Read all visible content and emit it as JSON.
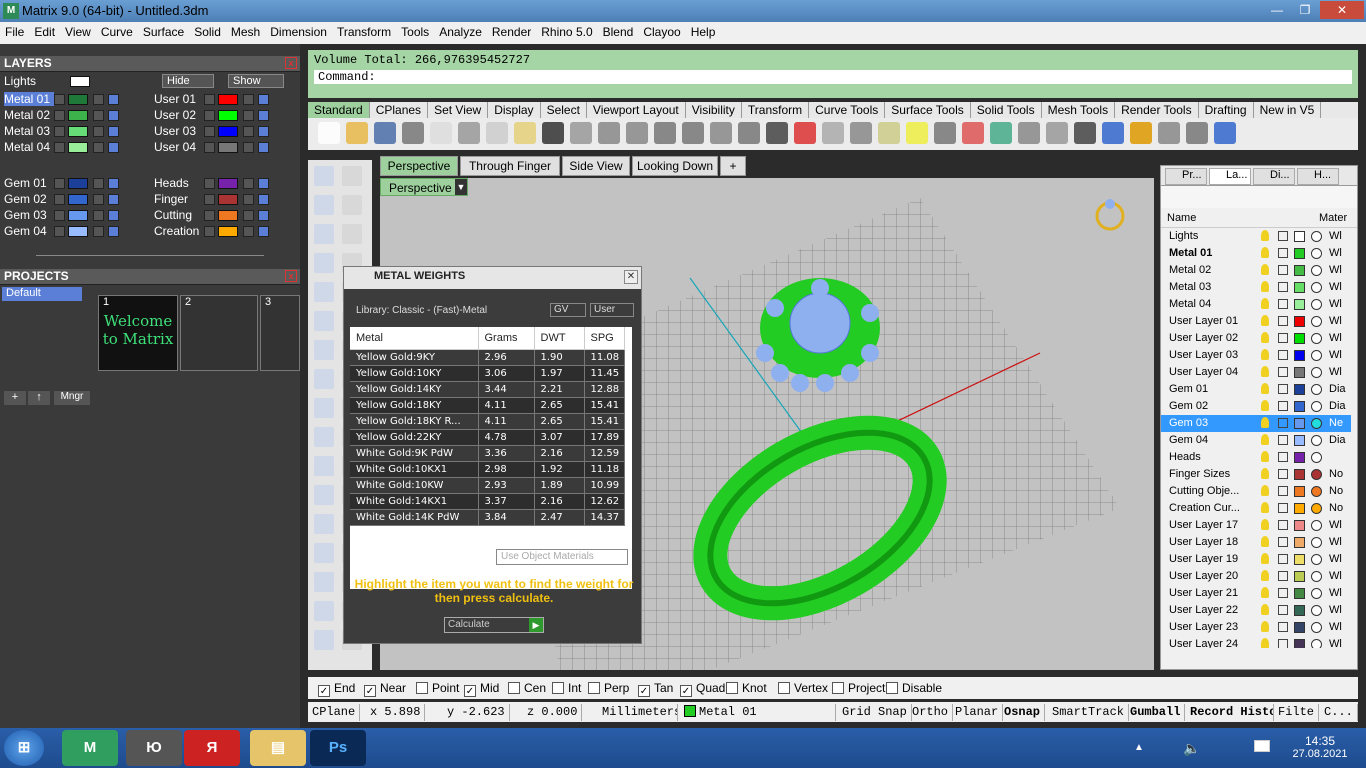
{
  "window": {
    "title": "Matrix 9.0 (64-bit) - Untitled.3dm"
  },
  "menu": [
    "File",
    "Edit",
    "View",
    "Curve",
    "Surface",
    "Solid",
    "Mesh",
    "Dimension",
    "Transform",
    "Tools",
    "Analyze",
    "Render",
    "Rhino 5.0",
    "Blend",
    "Clayoo",
    "Help"
  ],
  "layers_panel": {
    "title": "LAYERS",
    "lights": "Lights",
    "hide": "Hide",
    "show": "Show",
    "left": [
      {
        "name": "Metal 01",
        "color": "#1f7a3a"
      },
      {
        "name": "Metal 02",
        "color": "#3cb44b"
      },
      {
        "name": "Metal 03",
        "color": "#66dd77"
      },
      {
        "name": "Metal 04",
        "color": "#99ee99"
      }
    ],
    "right": [
      {
        "name": "User 01",
        "color": "#ff0000"
      },
      {
        "name": "User 02",
        "color": "#00ff00"
      },
      {
        "name": "User 03",
        "color": "#0000ff"
      },
      {
        "name": "User 04",
        "color": "#777777"
      }
    ],
    "gems": [
      {
        "name": "Gem 01",
        "color": "#1c3f99"
      },
      {
        "name": "Gem 02",
        "color": "#3366cc"
      },
      {
        "name": "Gem 03",
        "color": "#6699ee"
      },
      {
        "name": "Gem 04",
        "color": "#99bbff"
      }
    ],
    "other": [
      {
        "name": "Heads",
        "color": "#7722aa"
      },
      {
        "name": "Finger",
        "color": "#aa3333"
      },
      {
        "name": "Cutting",
        "color": "#ee7722"
      },
      {
        "name": "Creation",
        "color": "#ffaa00"
      }
    ]
  },
  "projects_panel": {
    "title": "PROJECTS",
    "item": "Default",
    "slots": [
      "1",
      "2",
      "3"
    ],
    "welcome": "Welcome to Matrix",
    "mngr": "Mngr"
  },
  "command": {
    "volume": "Volume Total: 266,976395452727",
    "prompt": "Command:"
  },
  "toolbar_tabs": [
    "Standard",
    "CPlanes",
    "Set View",
    "Display",
    "Select",
    "Viewport Layout",
    "Visibility",
    "Transform",
    "Curve Tools",
    "Surface Tools",
    "Solid Tools",
    "Mesh Tools",
    "Render Tools",
    "Drafting",
    "New in V5"
  ],
  "view_tabs": [
    "Perspective",
    "Through Finger",
    "Side View",
    "Looking Down",
    "+"
  ],
  "viewport_label": "Perspective",
  "metal_weights": {
    "title": "METAL WEIGHTS",
    "library": "Library: Classic - (Fast)-Metal",
    "gv": "GV",
    "user": "User",
    "columns": [
      "Metal",
      "Grams",
      "DWT",
      "SPG"
    ],
    "rows": [
      [
        "Yellow Gold:9KY",
        "2.96",
        "1.90",
        "11.08"
      ],
      [
        "Yellow Gold:10KY",
        "3.06",
        "1.97",
        "11.45"
      ],
      [
        "Yellow Gold:14KY",
        "3.44",
        "2.21",
        "12.88"
      ],
      [
        "Yellow Gold:18KY",
        "4.11",
        "2.65",
        "15.41"
      ],
      [
        "Yellow Gold:18KY R...",
        "4.11",
        "2.65",
        "15.41"
      ],
      [
        "Yellow Gold:22KY",
        "4.78",
        "3.07",
        "17.89"
      ],
      [
        "White Gold:9K PdW",
        "3.36",
        "2.16",
        "12.59"
      ],
      [
        "White Gold:10KX1",
        "2.98",
        "1.92",
        "11.18"
      ],
      [
        "White Gold:10KW",
        "2.93",
        "1.89",
        "10.99"
      ],
      [
        "White Gold:14KX1",
        "3.37",
        "2.16",
        "12.62"
      ],
      [
        "White Gold:14K PdW",
        "3.84",
        "2.47",
        "14.37"
      ]
    ],
    "use_object": "Use Object Materials",
    "note": "Highlight the item you want to find the weight for then press calculate.",
    "calculate": "Calculate"
  },
  "right_panel": {
    "tabs": [
      "Pr...",
      "La...",
      "Di...",
      "H..."
    ],
    "col_name": "Name",
    "col_mat": "Mater",
    "layers": [
      {
        "name": "Lights",
        "color": "#ffffff",
        "m": "Wl"
      },
      {
        "name": "Metal 01",
        "color": "#22cc22",
        "m": "Wl",
        "bold": true
      },
      {
        "name": "Metal 02",
        "color": "#44bb44",
        "m": "Wl"
      },
      {
        "name": "Metal 03",
        "color": "#66dd66",
        "m": "Wl"
      },
      {
        "name": "Metal 04",
        "color": "#99ee99",
        "m": "Wl"
      },
      {
        "name": "User Layer 01",
        "color": "#ee0000",
        "m": "Wl"
      },
      {
        "name": "User Layer 02",
        "color": "#00dd00",
        "m": "Wl"
      },
      {
        "name": "User Layer 03",
        "color": "#0000ee",
        "m": "Wl"
      },
      {
        "name": "User Layer 04",
        "color": "#777777",
        "m": "Wl"
      },
      {
        "name": "Gem 01",
        "color": "#1c3f99",
        "m": "Dia"
      },
      {
        "name": "Gem 02",
        "color": "#3366cc",
        "m": "Dia"
      },
      {
        "name": "Gem 03",
        "color": "#6699ee",
        "m": "Ne",
        "sel": true
      },
      {
        "name": "Gem 04",
        "color": "#99bbff",
        "m": "Dia"
      },
      {
        "name": "Heads",
        "color": "#7722aa",
        "m": ""
      },
      {
        "name": "Finger Sizes",
        "color": "#aa3333",
        "m": "No"
      },
      {
        "name": "Cutting Obje...",
        "color": "#ee7722",
        "m": "No"
      },
      {
        "name": "Creation Cur...",
        "color": "#ffaa00",
        "m": "No"
      },
      {
        "name": "User Layer 17",
        "color": "#ee8888",
        "m": "Wl"
      },
      {
        "name": "User Layer 18",
        "color": "#eeaa66",
        "m": "Wl"
      },
      {
        "name": "User Layer 19",
        "color": "#eedd66",
        "m": "Wl"
      },
      {
        "name": "User Layer 20",
        "color": "#bbcc55",
        "m": "Wl"
      },
      {
        "name": "User Layer 21",
        "color": "#448844",
        "m": "Wl"
      },
      {
        "name": "User Layer 22",
        "color": "#336655",
        "m": "Wl"
      },
      {
        "name": "User Layer 23",
        "color": "#334466",
        "m": "Wl"
      },
      {
        "name": "User Layer 24",
        "color": "#443355",
        "m": "Wl"
      }
    ]
  },
  "osnap": [
    {
      "label": "End",
      "checked": true
    },
    {
      "label": "Near",
      "checked": true
    },
    {
      "label": "Point",
      "checked": false
    },
    {
      "label": "Mid",
      "checked": true
    },
    {
      "label": "Cen",
      "checked": false
    },
    {
      "label": "Int",
      "checked": false
    },
    {
      "label": "Perp",
      "checked": false
    },
    {
      "label": "Tan",
      "checked": true
    },
    {
      "label": "Quad",
      "checked": true
    },
    {
      "label": "Knot",
      "checked": false
    },
    {
      "label": "Vertex",
      "checked": false
    },
    {
      "label": "Project",
      "checked": false
    },
    {
      "label": "Disable",
      "checked": false
    }
  ],
  "status": {
    "cplane": "CPlane",
    "x": "x 5.898",
    "y": "y -2.623",
    "z": "z 0.000",
    "units": "Millimeters",
    "layer": "Metal 01",
    "grid": "Grid Snap",
    "ortho": "Ortho",
    "planar": "Planar",
    "osnap": "Osnap",
    "smarttrack": "SmartTrack",
    "gumball": "Gumball",
    "record": "Record Histo",
    "filter": "Filte",
    "c": "C..."
  },
  "taskbar": {
    "time": "14:35",
    "date": "27.08.2021",
    "lang": "Ю",
    "ps": "Ps"
  }
}
